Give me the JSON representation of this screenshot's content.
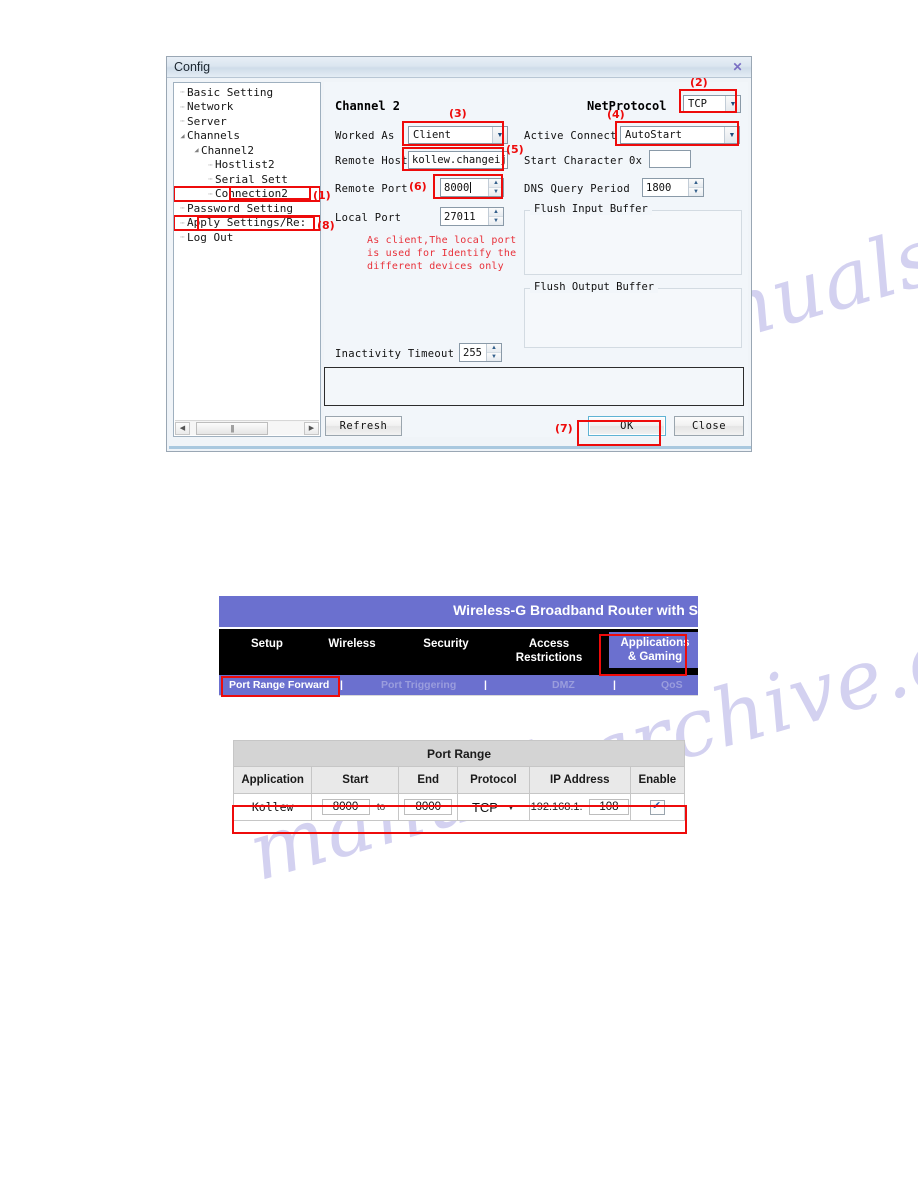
{
  "watermark": {
    "text_a": "manualsarchive.com",
    "text_b": "manualsarchive.com"
  },
  "config_dialog": {
    "title": "Config",
    "close_icon": "close-x-icon",
    "tree": {
      "items": [
        {
          "label": "Basic Setting",
          "indent": 0,
          "expander": "none",
          "highlight": false
        },
        {
          "label": "Network",
          "indent": 0,
          "expander": "none",
          "highlight": false
        },
        {
          "label": "Server",
          "indent": 0,
          "expander": "none",
          "highlight": false
        },
        {
          "label": "Channels",
          "indent": 0,
          "expander": "expanded",
          "highlight": false
        },
        {
          "label": "Channel2",
          "indent": 1,
          "expander": "expanded",
          "highlight": false
        },
        {
          "label": "Hostlist2",
          "indent": 2,
          "expander": "none",
          "highlight": false
        },
        {
          "label": "Serial Sett",
          "indent": 2,
          "expander": "none",
          "highlight": false
        },
        {
          "label": "Connection2",
          "indent": 2,
          "expander": "none",
          "highlight": true
        },
        {
          "label": "Password Setting",
          "indent": 0,
          "expander": "none",
          "highlight": false
        },
        {
          "label": "Apply Settings/Re:",
          "indent": 0,
          "expander": "none",
          "highlight": true
        },
        {
          "label": "Log Out",
          "indent": 0,
          "expander": "none",
          "highlight": false
        }
      ],
      "scroll_left_icon": "scroll-left-arrow-icon",
      "scroll_right_icon": "scroll-right-arrow-icon",
      "thumb_grip": "|||"
    },
    "form": {
      "channel_heading": "Channel 2",
      "netprotocol_label": "NetProtocol",
      "netprotocol_value": "TCP",
      "worked_as_label": "Worked As",
      "worked_as_value": "Client",
      "active_connect_label": "Active Connect",
      "active_connect_value": "AutoStart",
      "remote_host_label": "Remote Host",
      "remote_host_value": "kollew.changeij",
      "start_character_label": "Start Character",
      "start_character_prefix": "0x",
      "start_character_value": "",
      "remote_port_label": "Remote Port",
      "remote_port_value": "8000",
      "dns_query_label": "DNS Query Period",
      "dns_query_value": "1800",
      "local_port_label": "Local Port",
      "local_port_value": "27011",
      "flush_input_label": "Flush Input Buffer",
      "flush_output_label": "Flush Output Buffer",
      "inactivity_label": "Inactivity Timeout",
      "inactivity_value": "255",
      "red_note": "As client,The local port\nis used for Identify the\ndifferent devices only",
      "spin_up_icon": "spinner-up-arrow-icon",
      "spin_dn_icon": "spinner-down-arrow-icon",
      "combo_arrow_icon": "chevron-down-icon"
    },
    "buttons": {
      "refresh": "Refresh",
      "ok": "OK",
      "close": "Close"
    },
    "markers": {
      "m1": "(1)",
      "m2": "(2)",
      "m3": "(3)",
      "m4": "(4)",
      "m5": "(5)",
      "m6": "(6)",
      "m7": "(7)",
      "m8": "(8)"
    },
    "accent_red": "#ee0b0b"
  },
  "router_ui": {
    "banner_title": "Wireless-G Broadband Router with S",
    "brand_color": "#6b70cf",
    "nav_tabs": [
      {
        "label": "Setup",
        "active": false
      },
      {
        "label": "Wireless",
        "active": false
      },
      {
        "label": "Security",
        "active": false
      },
      {
        "label": "Access\nRestrictions",
        "active": false
      },
      {
        "label": "Applications\n& Gaming",
        "active": true
      }
    ],
    "subnav": [
      {
        "label": "Port Range Forward",
        "selected": true
      },
      {
        "label": "Port Triggering",
        "selected": false
      },
      {
        "label": "DMZ",
        "selected": false
      },
      {
        "label": "QoS",
        "selected": false
      }
    ],
    "subnav_separator": "|"
  },
  "port_range_table": {
    "title": "Port Range",
    "columns": [
      "Application",
      "Start",
      "End",
      "Protocol",
      "IP Address",
      "Enable"
    ],
    "to_word": "to",
    "rows": [
      {
        "application": "Kollew",
        "start": "8000",
        "end": "8000",
        "protocol": "TCP",
        "ip_prefix": "192.168.1.",
        "ip_suffix": "108",
        "enabled": true
      }
    ],
    "protocol_caret_icon": "chevron-down-icon",
    "enable_checkbox_icon": "checkbox-checked-icon"
  }
}
